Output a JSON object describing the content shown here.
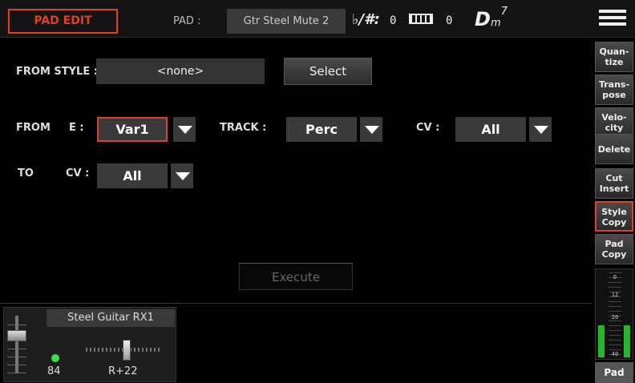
{
  "header": {
    "title": "PAD EDIT",
    "pad_label": "PAD :",
    "pad_name": "Gtr Steel Mute 2",
    "accidentals_label": "♭/#:",
    "accidentals_value": "0",
    "transpose_value": "0",
    "chord_root": "D",
    "chord_quality": "m",
    "chord_extension": "7"
  },
  "form": {
    "from_style_label": "FROM STYLE :",
    "from_style_value": "<none>",
    "select_label": "Select",
    "from_label": "FROM",
    "e_label": "E :",
    "e_value": "Var1",
    "track_label": "TRACK :",
    "track_value": "Perc",
    "cv_label": "CV :",
    "cv_value": "All",
    "to_label": "TO",
    "to_cv_label": "CV :",
    "to_cv_value": "All",
    "execute_label": "Execute"
  },
  "channel": {
    "name": "Steel Guitar RX1",
    "volume": "84",
    "pan": "R+22"
  },
  "sidebar": {
    "buttons": [
      {
        "line1": "Quan-",
        "line2": "tize"
      },
      {
        "line1": "Trans-",
        "line2": "pose"
      },
      {
        "line1": "Velo-",
        "line2": "city"
      },
      {
        "line1": "Delete",
        "line2": ""
      },
      {
        "line1": "Cut",
        "line2": "Insert"
      },
      {
        "line1": "Style",
        "line2": "Copy"
      },
      {
        "line1": "Pad",
        "line2": "Copy"
      }
    ],
    "meter_scale": [
      "0",
      "12",
      "20",
      "40"
    ],
    "meter_level": 0.36,
    "tab_label": "Pad"
  },
  "colors": {
    "accent": "#e2401f",
    "led": "#3ee04a",
    "meter": "#28b528"
  }
}
